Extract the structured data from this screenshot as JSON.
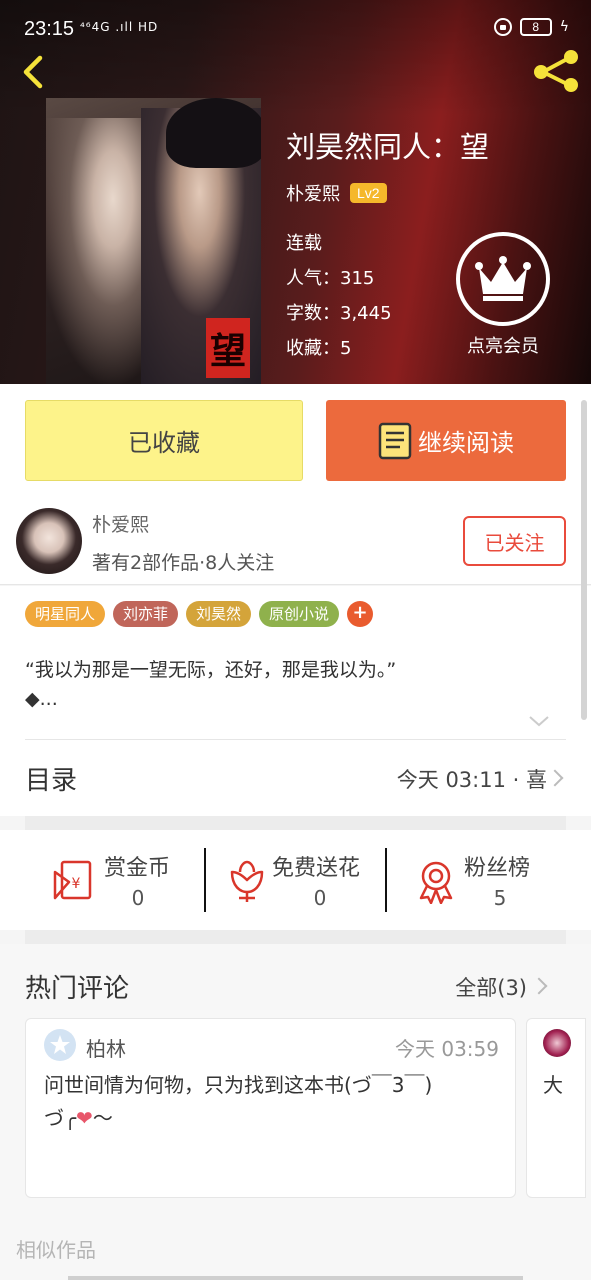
{
  "status_bar": {
    "time": "23:15",
    "signal": "⁴⁶4G .ıll HD",
    "battery": "8"
  },
  "book": {
    "title": "刘昊然同人：望",
    "author": "朴爱熙",
    "level": "Lv2",
    "status": "连载",
    "popularity_label": "人气：",
    "popularity": "315",
    "word_count_label": "字数：",
    "word_count": "3,445",
    "favorites_label": "收藏：",
    "favorites": "5",
    "cover_stamp": "望"
  },
  "vip": {
    "label": "点亮会员"
  },
  "actions": {
    "collected_label": "已收藏",
    "read_label": "继续阅读"
  },
  "author_card": {
    "name": "朴爱熙",
    "stats": "著有2部作品·8人关注",
    "follow_label": "已关注"
  },
  "tags": [
    {
      "label": "明星同人",
      "color": "#f0a73a"
    },
    {
      "label": "刘亦菲",
      "color": "#c0665a"
    },
    {
      "label": "刘昊然",
      "color": "#d4a43a"
    },
    {
      "label": "原创小说",
      "color": "#8fb14c"
    }
  ],
  "tag_add": "+",
  "intro": {
    "line1": "“我以为那是一望无际，还好，那是我以为。”",
    "line2": "◆..."
  },
  "toc": {
    "title": "目录",
    "latest": "今天 03:11 · 喜"
  },
  "stats": [
    {
      "label": "赏金币",
      "value": "0",
      "icon": "red-envelope-icon"
    },
    {
      "label": "免费送花",
      "value": "0",
      "icon": "flower-icon"
    },
    {
      "label": "粉丝榜",
      "value": "5",
      "icon": "medal-icon"
    }
  ],
  "comments": {
    "title": "热门评论",
    "all_label": "全部(3)",
    "items": [
      {
        "user": "柏林",
        "time": "今天 03:59",
        "text_line1": "问世间情为何物，只为找到这本书(づ￣3￣)",
        "text_line2_prefix": "づ╭",
        "text_line2_heart": "❤",
        "text_line2_suffix": "～"
      },
      {
        "text": "大"
      }
    ]
  },
  "similar": {
    "title": "相似作品"
  },
  "colors": {
    "accent_orange": "#ec6a3d",
    "collected_yellow": "#fdf38a",
    "follow_red": "#e94b3c",
    "level_gold": "#f5b82b",
    "share_yellow": "#f5e23a"
  }
}
